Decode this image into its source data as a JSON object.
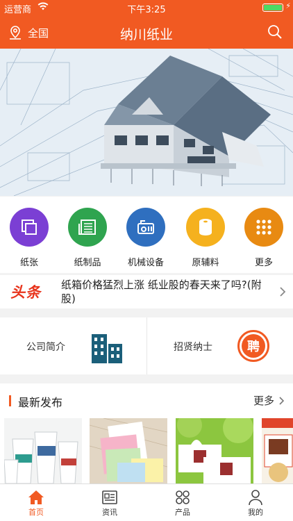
{
  "status_bar": {
    "carrier": "运营商",
    "time": "下午3:25"
  },
  "nav": {
    "location": "全国",
    "title": "纳川纸业"
  },
  "categories": [
    {
      "label": "纸张",
      "color": "#7b3fd4"
    },
    {
      "label": "纸制品",
      "color": "#2fa44f"
    },
    {
      "label": "机械设备",
      "color": "#2f6fbf"
    },
    {
      "label": "原辅料",
      "color": "#f5b11e"
    },
    {
      "label": "更多",
      "color": "#e88a12"
    }
  ],
  "headline": {
    "badge": "头条",
    "text": "纸箱价格猛烈上涨 纸业股的春天来了吗?(附股)"
  },
  "infos": {
    "about": {
      "label": "公司简介",
      "icon": "building-icon"
    },
    "recruit": {
      "label": "招贤纳士",
      "icon_text": "聘"
    }
  },
  "latest": {
    "title": "最新发布",
    "more": "更多"
  },
  "tabs": [
    {
      "label": "首页",
      "active": true
    },
    {
      "label": "资讯",
      "active": false
    },
    {
      "label": "产品",
      "active": false
    },
    {
      "label": "我的",
      "active": false
    }
  ],
  "colors": {
    "brand": "#f15a22"
  }
}
